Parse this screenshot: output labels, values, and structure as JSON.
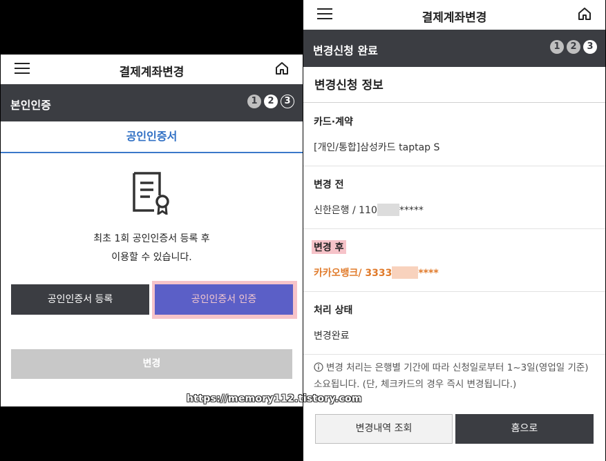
{
  "left": {
    "header": {
      "title": "결제계좌변경"
    },
    "stepbar": {
      "title": "본인인증",
      "steps": [
        "1",
        "2",
        "3"
      ]
    },
    "tab": {
      "label": "공인인증서"
    },
    "message": {
      "line1": "최초 1회 공인인증서 등록 후",
      "line2": "이용할 수 있습니다."
    },
    "buttons": {
      "register": "공인인증서 등록",
      "authenticate": "공인인증서 인증",
      "change": "변경"
    }
  },
  "right": {
    "header": {
      "title": "결제계좌변경"
    },
    "stepbar": {
      "title": "변경신청 완료",
      "steps": [
        "1",
        "2",
        "3"
      ]
    },
    "section_title": "변경신청 정보",
    "rows": [
      {
        "label": "카드·계약",
        "value": "[개인/통합]삼성카드 taptap S"
      },
      {
        "label": "변경 전",
        "value_prefix": "신한은행 / 110",
        "value_suffix": "*****"
      },
      {
        "label": "변경 후",
        "value_prefix": "카카오뱅크/ 3333",
        "value_suffix": "****"
      },
      {
        "label": "처리 상태",
        "value": "변경완료"
      }
    ],
    "notice": "변경 처리는 은행별 기간에 따라 신청일로부터 1~3일(영업일 기준) 소요됩니다. (단, 체크카드의 경우 즉시 변경됩니다.)",
    "buttons": {
      "history": "변경내역 조회",
      "home": "홈으로"
    }
  },
  "watermark": "https://memory112.tistory.com",
  "colors": {
    "stepbar": "#3b3d42",
    "accent_blue": "#3a78c9",
    "primary_button": "#5b5fc7",
    "highlight_orange": "#e07a2a",
    "highlight_pink": "#f6c3c9"
  }
}
